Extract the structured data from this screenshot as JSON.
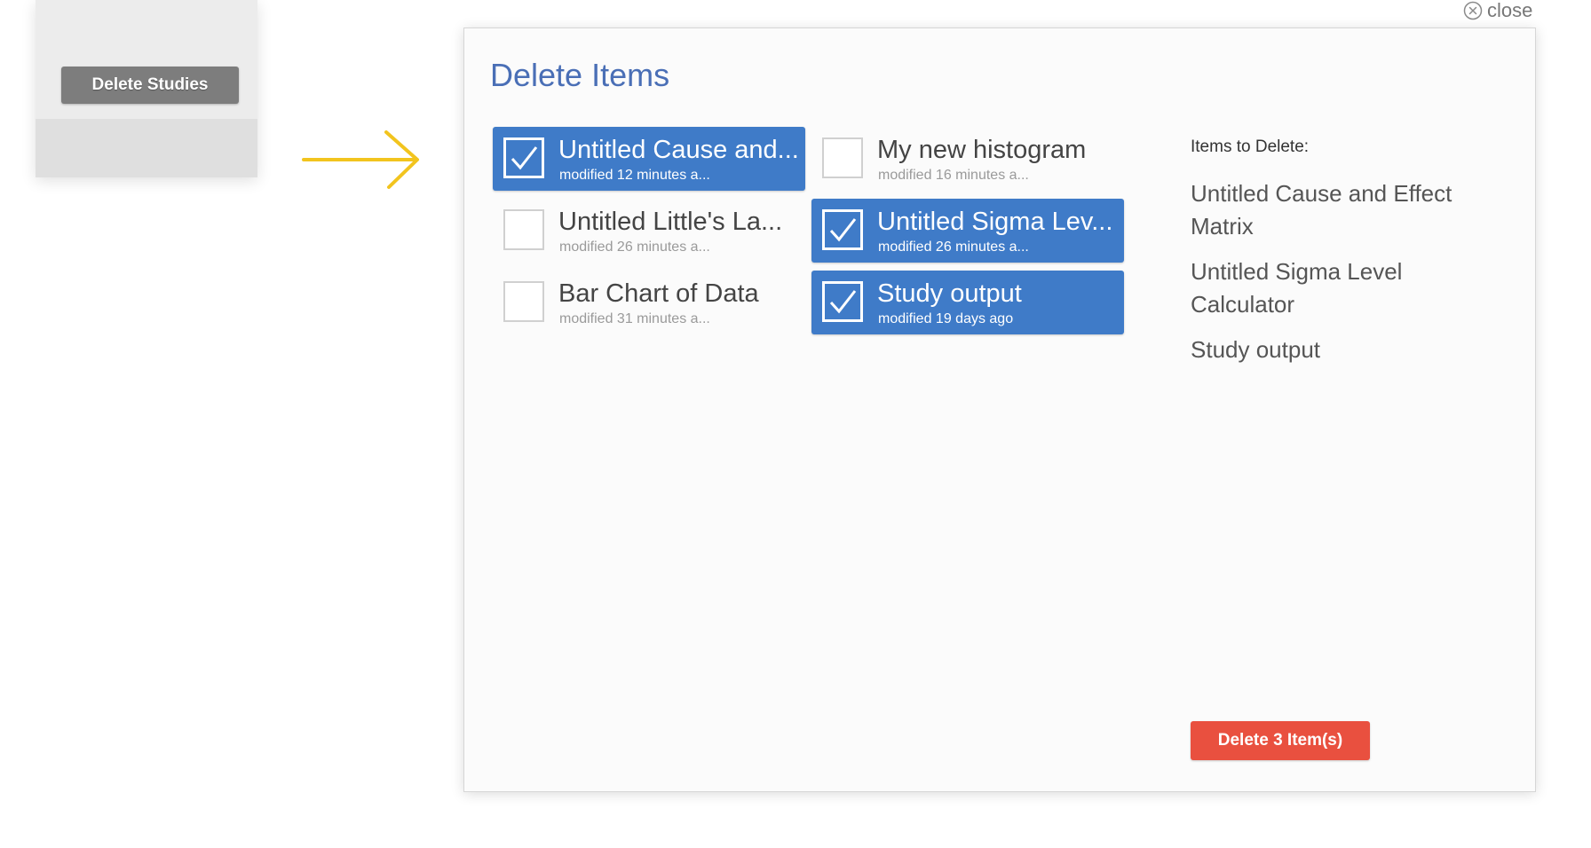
{
  "background_panel": {
    "delete_studies_label": "Delete Studies"
  },
  "close": {
    "label": "close",
    "icon": "close-circle-icon"
  },
  "arrow": {
    "icon": "arrow-right-icon",
    "color": "#f2c41e"
  },
  "dialog": {
    "title": "Delete Items",
    "items": [
      {
        "title": "Untitled Cause and...",
        "subtitle": "modified 12 minutes a...",
        "selected": true
      },
      {
        "title": "My new histogram",
        "subtitle": "modified 16 minutes a...",
        "selected": false
      },
      {
        "title": "Untitled Little's La...",
        "subtitle": "modified 26 minutes a...",
        "selected": false
      },
      {
        "title": "Untitled Sigma Lev...",
        "subtitle": "modified 26 minutes a...",
        "selected": true
      },
      {
        "title": "Bar Chart of Data",
        "subtitle": "modified 31 minutes a...",
        "selected": false
      },
      {
        "title": "Study output",
        "subtitle": "modified 19 days ago",
        "selected": true
      }
    ],
    "to_delete": {
      "heading": "Items to Delete:",
      "items": [
        "Untitled Cause and Effect Matrix",
        "Untitled Sigma Level Calculator",
        "Study output"
      ]
    },
    "delete_button_label": "Delete 3 Item(s)"
  },
  "colors": {
    "selected_blue": "#3f7bc8",
    "title_blue": "#4a6fb6",
    "delete_red": "#e9503f",
    "arrow_yellow": "#f2c41e"
  }
}
